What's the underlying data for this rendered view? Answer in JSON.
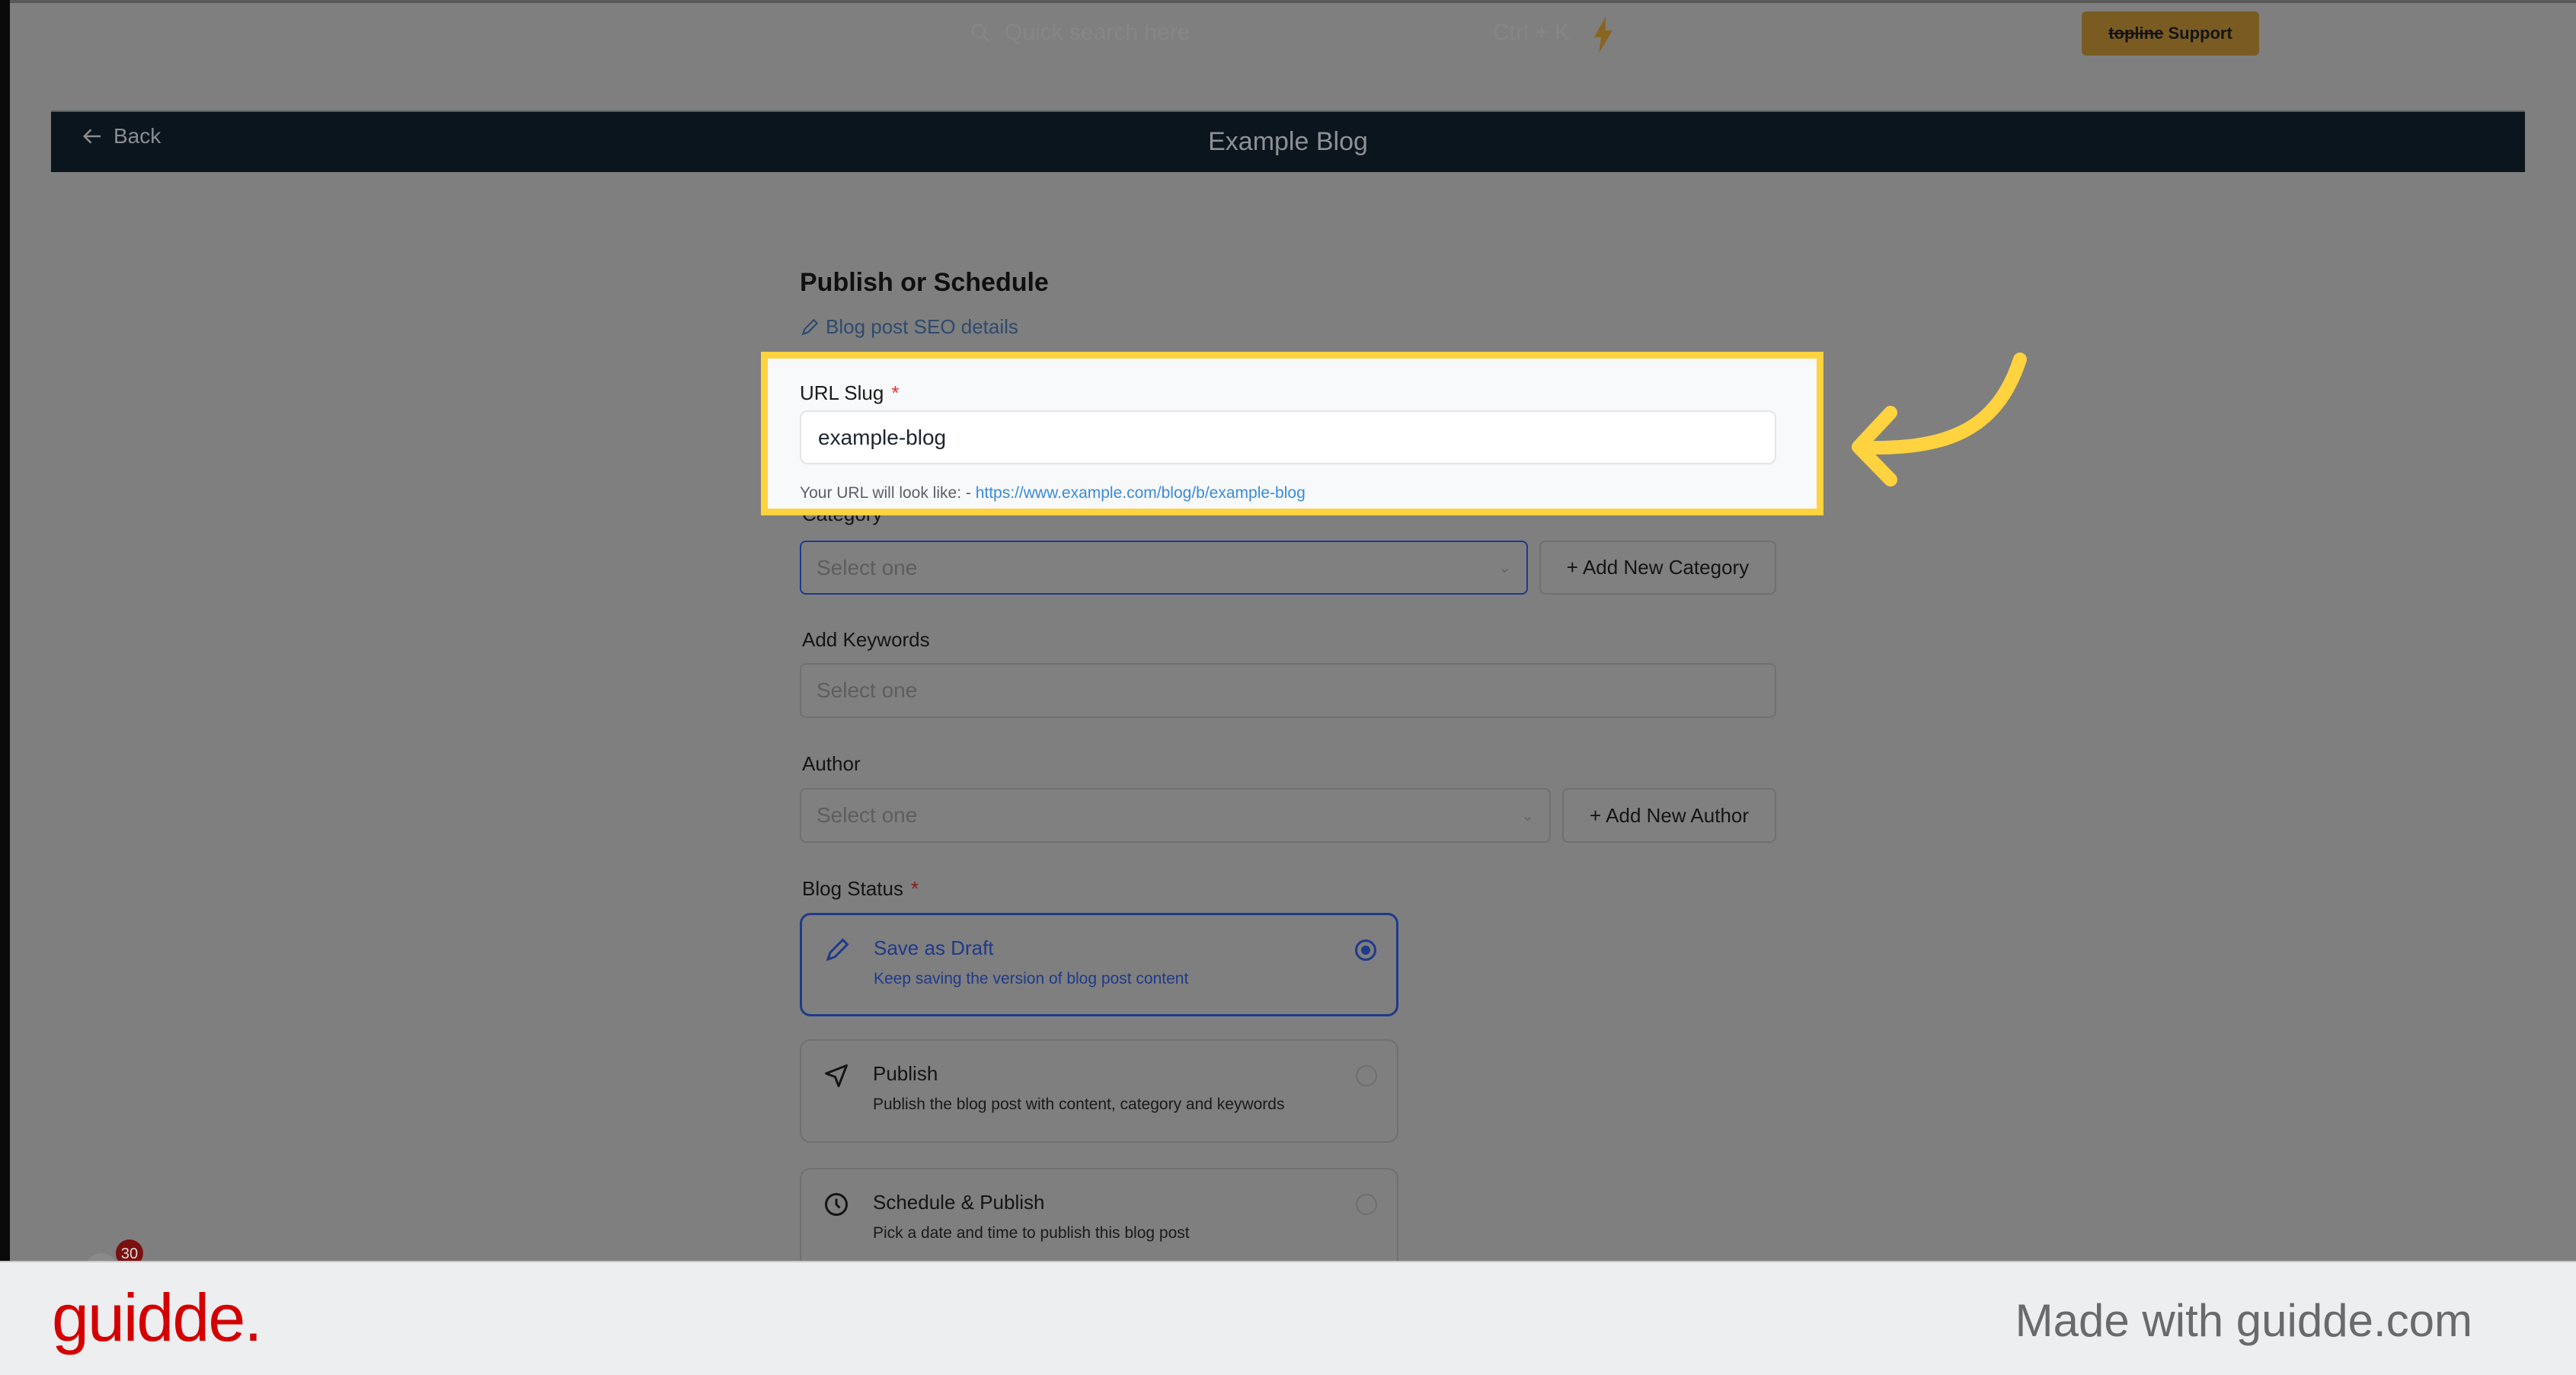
{
  "topbar": {
    "search_placeholder": "Quick search here",
    "shortcut": "Ctrl + K",
    "support_brand": "topline",
    "support_label": "Support"
  },
  "header": {
    "back_label": "Back",
    "title": "Example Blog"
  },
  "form": {
    "title": "Publish or Schedule",
    "seo_link": "Blog post SEO details",
    "url_slug": {
      "label": "URL Slug",
      "required": "*",
      "value": "example-blog",
      "help_prefix": "Your URL will look like: - ",
      "help_url": "https://www.example.com/blog/b/example-blog"
    },
    "category": {
      "label": "Category",
      "placeholder": "Select one",
      "add_label": "Add New Category"
    },
    "keywords": {
      "label": "Add Keywords",
      "placeholder": "Select one"
    },
    "author": {
      "label": "Author",
      "placeholder": "Select one",
      "add_label": "Add New Author"
    },
    "blog_status": {
      "label": "Blog Status",
      "required": "*",
      "options": [
        {
          "title": "Save as Draft",
          "desc": "Keep saving the version of blog post content",
          "icon": "pencil-icon",
          "selected": true
        },
        {
          "title": "Publish",
          "desc": "Publish the blog post with content, category and keywords",
          "icon": "send-icon",
          "selected": false
        },
        {
          "title": "Schedule & Publish",
          "desc": "Pick a date and time to publish this blog post",
          "icon": "clock-icon",
          "selected": false
        }
      ]
    }
  },
  "notification_badge": "30",
  "footer": {
    "logo": "guidde.",
    "made_with": "Made with guidde.com"
  },
  "colors": {
    "highlight": "#ffd23f",
    "header_bg": "#0b151e",
    "selected": "#1e3a8a",
    "brand_red": "#d40000"
  }
}
